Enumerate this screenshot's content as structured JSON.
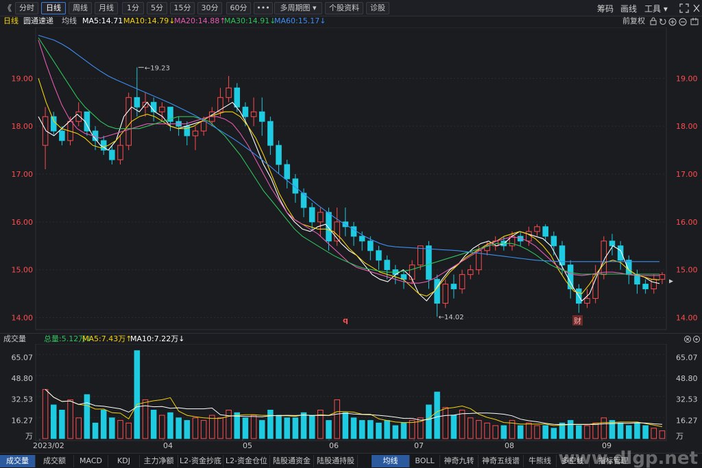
{
  "toolbar": {
    "back_icon": "《",
    "buttons": [
      "分时",
      "日线",
      "周线",
      "月线",
      "1分",
      "5分",
      "15分",
      "30分",
      "60分",
      "•••",
      "多周期图 ▾",
      "个股资料",
      "诊股"
    ],
    "active": "日线",
    "right": [
      "筹码",
      "画线",
      "工具 ▾"
    ]
  },
  "info": {
    "period": "日线",
    "name": "圆通速递",
    "avg_label": "均线",
    "ma5": "MA5:14.71",
    "ma10": "MA10:14.79↓",
    "ma20": "MA20:14.88↑",
    "ma30": "MA30:14.91↓",
    "ma60": "MA60:15.17↓",
    "adjust": "前复权"
  },
  "colors": {
    "up": "#ff4d4f",
    "down": "#1ecbe1",
    "ma5": "#ffffff",
    "ma10": "#f5d20b",
    "ma20": "#e55bb2",
    "ma30": "#2fc25b",
    "ma60": "#3d8ef0",
    "axis": "#ff4d4f"
  },
  "chart_data": [
    {
      "type": "candlestick",
      "title": "",
      "ylim": [
        13.85,
        19.95
      ],
      "y_ticks": [
        "19.00",
        "18.00",
        "17.00",
        "16.00",
        "15.00",
        "14.00"
      ],
      "x_ticks": [
        "2023/02",
        "04",
        "05",
        "06",
        "07",
        "08",
        "09"
      ],
      "annotations": [
        {
          "text": "19.23",
          "kind": "high"
        },
        {
          "text": "14.02",
          "kind": "low"
        }
      ],
      "markers": [
        "q",
        "财"
      ],
      "series": [
        {
          "name": "MA5",
          "values": [
            18.2,
            17.9,
            17.8,
            17.95,
            18.1,
            18.25,
            18.1,
            17.8,
            17.6,
            17.5,
            17.7,
            18.2,
            18.4,
            18.3,
            18.5,
            18.3,
            18.2,
            18.0,
            17.95,
            18.0,
            18.05,
            18.1,
            18.2,
            18.3,
            18.4,
            18.5,
            18.3,
            18.0,
            17.6,
            17.2,
            16.9,
            16.5,
            16.2,
            16.0,
            15.85,
            15.8,
            15.9,
            15.95,
            15.75,
            15.55,
            15.4,
            15.3,
            15.1,
            14.9,
            14.8,
            14.75,
            14.9,
            15.0,
            14.85,
            14.5,
            14.35,
            14.55,
            14.8,
            15.0,
            15.1,
            15.3,
            15.45,
            15.55,
            15.6,
            15.5,
            15.55,
            15.7,
            15.8,
            15.75,
            15.7,
            15.65,
            15.5,
            15.2,
            14.9,
            14.6,
            14.35,
            14.5,
            14.9,
            15.25,
            15.5,
            15.4,
            15.0,
            14.9,
            14.85,
            14.75,
            14.71
          ]
        },
        {
          "name": "MA10",
          "values": [
            19.0,
            18.5,
            18.1,
            17.95,
            17.9,
            17.85,
            17.75,
            17.6,
            17.55,
            17.6,
            17.7,
            17.9,
            18.1,
            18.2,
            18.25,
            18.2,
            18.1,
            18.0,
            17.95,
            17.95,
            18.0,
            18.1,
            18.2,
            18.25,
            18.3,
            18.3,
            18.2,
            18.0,
            17.75,
            17.4,
            17.0,
            16.6,
            16.3,
            16.05,
            15.95,
            15.9,
            15.85,
            15.85,
            15.8,
            15.65,
            15.45,
            15.3,
            15.15,
            15.05,
            14.95,
            14.9,
            14.85,
            14.8,
            14.65,
            14.5,
            14.45,
            14.55,
            14.75,
            14.95,
            15.1,
            15.25,
            15.35,
            15.45,
            15.55,
            15.6,
            15.7,
            15.75,
            15.8,
            15.75,
            15.65,
            15.5,
            15.3,
            15.0,
            14.75,
            14.55,
            14.5,
            14.7,
            14.95,
            15.15,
            15.2,
            15.15,
            15.0,
            14.9,
            14.85,
            14.8,
            14.79
          ]
        },
        {
          "name": "MA20",
          "values": [
            19.8,
            19.3,
            18.85,
            18.45,
            18.15,
            17.95,
            17.85,
            17.8,
            17.75,
            17.8,
            17.85,
            17.9,
            17.95,
            18.0,
            18.05,
            18.05,
            18.05,
            18.05,
            18.05,
            18.05,
            18.1,
            18.15,
            18.2,
            18.2,
            18.15,
            18.05,
            17.85,
            17.6,
            17.3,
            17.0,
            16.7,
            16.45,
            16.2,
            16.05,
            15.95,
            15.85,
            15.75,
            15.6,
            15.45,
            15.3,
            15.15,
            15.05,
            15.0,
            14.95,
            14.9,
            14.85,
            14.8,
            14.75,
            14.72,
            14.72,
            14.75,
            14.82,
            14.92,
            15.02,
            15.12,
            15.22,
            15.32,
            15.42,
            15.52,
            15.6,
            15.65,
            15.68,
            15.67,
            15.6,
            15.5,
            15.35,
            15.2,
            15.05,
            14.95,
            14.9,
            14.88,
            14.9,
            14.93,
            14.95,
            14.95,
            14.93,
            14.9,
            14.88,
            14.88,
            14.88,
            14.88
          ]
        },
        {
          "name": "MA30",
          "values": [
            19.85,
            19.6,
            19.35,
            19.1,
            18.85,
            18.6,
            18.4,
            18.25,
            18.1,
            18.0,
            17.95,
            17.95,
            17.95,
            17.95,
            18.0,
            18.05,
            18.1,
            18.15,
            18.2,
            18.2,
            18.2,
            18.15,
            18.1,
            17.95,
            17.8,
            17.6,
            17.4,
            17.15,
            16.9,
            16.65,
            16.45,
            16.25,
            16.05,
            15.85,
            15.7,
            15.6,
            15.5,
            15.4,
            15.3,
            15.22,
            15.15,
            15.08,
            15.03,
            15.0,
            14.97,
            14.95,
            14.95,
            14.97,
            15.0,
            15.05,
            15.1,
            15.15,
            15.2,
            15.25,
            15.3,
            15.35,
            15.4,
            15.45,
            15.5,
            15.55,
            15.55,
            15.55,
            15.5,
            15.42,
            15.32,
            15.2,
            15.1,
            15.02,
            14.97,
            14.93,
            14.91,
            14.91,
            14.91,
            14.91,
            14.91,
            14.91,
            14.91,
            14.91,
            14.91,
            14.91,
            14.91
          ]
        },
        {
          "name": "MA60",
          "values": [
            19.9,
            19.85,
            19.8,
            19.72,
            19.62,
            19.5,
            19.38,
            19.26,
            19.15,
            19.05,
            18.97,
            18.9,
            18.83,
            18.76,
            18.69,
            18.62,
            18.55,
            18.48,
            18.4,
            18.32,
            18.24,
            18.15,
            18.05,
            17.95,
            17.85,
            17.75,
            17.64,
            17.52,
            17.4,
            17.27,
            17.14,
            17.0,
            16.87,
            16.74,
            16.61,
            16.48,
            16.35,
            16.23,
            16.11,
            16.0,
            15.9,
            15.8,
            15.7,
            15.62,
            15.55,
            15.5,
            15.48,
            15.47,
            15.46,
            15.45,
            15.44,
            15.43,
            15.42,
            15.41,
            15.4,
            15.38,
            15.36,
            15.34,
            15.32,
            15.3,
            15.28,
            15.26,
            15.24,
            15.22,
            15.2,
            15.19,
            15.18,
            15.17,
            15.17,
            15.17,
            15.17,
            15.17,
            15.17,
            15.17,
            15.17,
            15.17,
            15.17,
            15.17,
            15.17,
            15.17,
            15.17
          ]
        }
      ],
      "candles": [
        [
          17.6,
          18.2,
          18.4,
          17.1
        ],
        [
          18.2,
          17.9,
          18.3,
          17.8
        ],
        [
          17.9,
          17.7,
          18.0,
          17.6
        ],
        [
          17.7,
          18.1,
          18.2,
          17.6
        ],
        [
          18.1,
          18.3,
          18.5,
          18.0
        ],
        [
          18.3,
          17.9,
          18.3,
          17.8
        ],
        [
          17.9,
          17.7,
          18.0,
          17.5
        ],
        [
          17.7,
          17.5,
          17.8,
          17.4
        ],
        [
          17.5,
          17.3,
          17.6,
          17.2
        ],
        [
          17.3,
          17.6,
          17.8,
          17.2
        ],
        [
          17.6,
          18.6,
          18.7,
          17.5
        ],
        [
          18.6,
          18.4,
          19.23,
          18.2
        ],
        [
          18.4,
          18.5,
          18.7,
          18.2
        ],
        [
          18.5,
          18.3,
          18.6,
          18.1
        ],
        [
          18.3,
          18.4,
          18.5,
          18.1
        ],
        [
          18.4,
          18.1,
          18.4,
          17.9
        ],
        [
          18.1,
          18.0,
          18.2,
          17.8
        ],
        [
          18.0,
          17.8,
          18.1,
          17.6
        ],
        [
          17.8,
          17.9,
          18.0,
          17.5
        ],
        [
          17.9,
          18.1,
          18.2,
          17.8
        ],
        [
          18.1,
          18.3,
          18.4,
          18.0
        ],
        [
          18.3,
          18.6,
          18.8,
          18.2
        ],
        [
          18.6,
          18.8,
          19.05,
          18.5
        ],
        [
          18.8,
          18.4,
          18.9,
          18.3
        ],
        [
          18.4,
          18.2,
          18.5,
          18.0
        ],
        [
          18.2,
          18.3,
          18.6,
          18.0
        ],
        [
          18.3,
          18.1,
          18.6,
          17.8
        ],
        [
          18.1,
          17.6,
          18.2,
          17.4
        ],
        [
          17.6,
          17.2,
          17.7,
          17.0
        ],
        [
          17.2,
          16.9,
          17.3,
          16.7
        ],
        [
          16.9,
          16.6,
          17.0,
          16.4
        ],
        [
          16.6,
          16.3,
          16.7,
          16.1
        ],
        [
          16.3,
          16.0,
          16.4,
          15.8
        ],
        [
          16.0,
          16.2,
          16.3,
          15.7
        ],
        [
          16.2,
          15.6,
          16.3,
          15.4
        ],
        [
          15.6,
          16.0,
          16.3,
          15.5
        ],
        [
          16.0,
          15.9,
          16.3,
          15.7
        ],
        [
          15.9,
          15.7,
          16.0,
          15.5
        ],
        [
          15.7,
          15.6,
          15.8,
          15.4
        ],
        [
          15.6,
          15.4,
          15.7,
          15.2
        ],
        [
          15.4,
          15.2,
          15.5,
          15.0
        ],
        [
          15.2,
          15.0,
          15.3,
          14.8
        ],
        [
          15.0,
          14.9,
          15.1,
          14.7
        ],
        [
          14.9,
          14.8,
          15.0,
          14.6
        ],
        [
          14.8,
          15.1,
          15.2,
          14.7
        ],
        [
          15.1,
          15.5,
          15.5,
          15.0
        ],
        [
          15.5,
          14.8,
          15.6,
          14.6
        ],
        [
          14.8,
          14.3,
          14.9,
          14.02
        ],
        [
          14.3,
          14.7,
          14.8,
          14.2
        ],
        [
          14.7,
          14.6,
          14.9,
          14.4
        ],
        [
          14.6,
          14.9,
          15.0,
          14.5
        ],
        [
          14.9,
          15.0,
          15.1,
          14.8
        ],
        [
          15.0,
          15.4,
          15.5,
          14.9
        ],
        [
          15.4,
          15.5,
          15.6,
          15.3
        ],
        [
          15.5,
          15.6,
          15.7,
          15.4
        ],
        [
          15.6,
          15.5,
          15.7,
          15.4
        ],
        [
          15.5,
          15.7,
          15.8,
          15.4
        ],
        [
          15.7,
          15.6,
          15.8,
          15.5
        ],
        [
          15.6,
          15.8,
          15.9,
          15.5
        ],
        [
          15.8,
          15.9,
          15.95,
          15.7
        ],
        [
          15.9,
          15.7,
          15.95,
          15.6
        ],
        [
          15.7,
          15.5,
          15.8,
          15.3
        ],
        [
          15.5,
          15.1,
          15.6,
          14.9
        ],
        [
          15.1,
          14.6,
          15.2,
          14.4
        ],
        [
          14.6,
          14.3,
          14.7,
          14.1
        ],
        [
          14.3,
          14.4,
          14.6,
          14.2
        ],
        [
          14.4,
          14.9,
          15.1,
          14.3
        ],
        [
          14.9,
          15.6,
          15.7,
          14.8
        ],
        [
          15.6,
          15.5,
          15.75,
          15.3
        ],
        [
          15.5,
          15.2,
          15.6,
          15.0
        ],
        [
          15.2,
          14.9,
          15.3,
          14.7
        ],
        [
          14.9,
          14.7,
          15.0,
          14.5
        ],
        [
          14.7,
          14.6,
          14.8,
          14.5
        ],
        [
          14.6,
          14.8,
          14.9,
          14.5
        ],
        [
          14.8,
          14.9,
          14.95,
          14.7
        ]
      ]
    },
    {
      "type": "bar",
      "title": "成交量",
      "unit": "万",
      "ylim": [
        0,
        70
      ],
      "y_ticks": [
        "65.07",
        "48.80",
        "32.53",
        "16.27",
        "万"
      ],
      "legend": {
        "total": "总量:5.12万↓",
        "ma5": "MA5:7.43万↑",
        "ma10": "MA10:7.22万↓"
      },
      "values": [
        38,
        26,
        22,
        30,
        16,
        34,
        12,
        22,
        16,
        14,
        12,
        68,
        30,
        22,
        18,
        20,
        16,
        14,
        16,
        14,
        18,
        16,
        22,
        20,
        16,
        18,
        14,
        22,
        18,
        16,
        16,
        20,
        18,
        22,
        14,
        30,
        20,
        16,
        14,
        14,
        12,
        14,
        10,
        12,
        14,
        16,
        26,
        36,
        24,
        18,
        22,
        16,
        14,
        12,
        10,
        10,
        14,
        10,
        12,
        10,
        10,
        8,
        12,
        14,
        10,
        10,
        12,
        16,
        14,
        12,
        10,
        12,
        10,
        8,
        6
      ]
    }
  ],
  "vol_header": {
    "title": "成交量"
  },
  "bottom_tabs": [
    "成交量",
    "成交额",
    "MACD",
    "KDJ",
    "主力净额",
    "L2-资金抄底",
    "L2-资金仓位",
    "陆股通资金",
    "陆股通持股",
    "均线",
    "BOLL",
    "神奇九转",
    "神奇五线谱",
    "牛熊线",
    "多空线",
    "指标管理"
  ],
  "bottom_active": [
    "成交量",
    "均线"
  ],
  "watermark": "www.dlgp.net"
}
